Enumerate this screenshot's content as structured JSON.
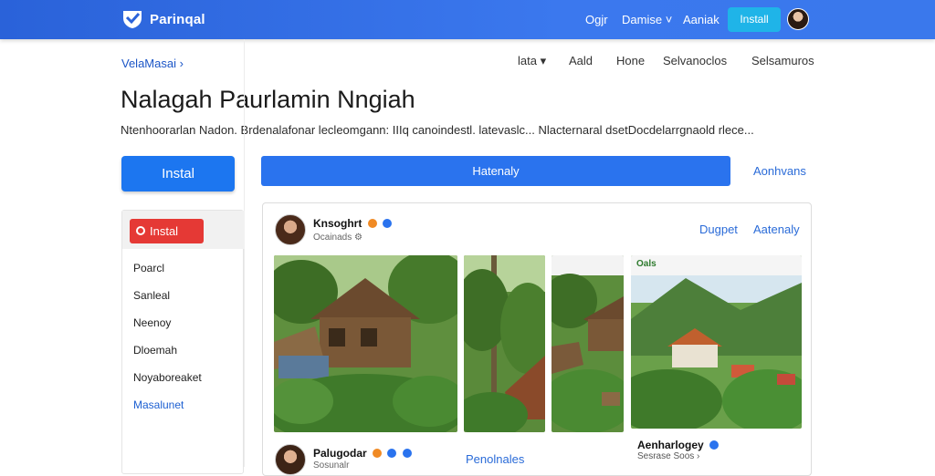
{
  "header": {
    "brand": "Parinqal",
    "nav": [
      "Ogjr",
      "Damise"
    ],
    "nav_third": "Aaniak",
    "install_label": "Install"
  },
  "breadcrumb": "VelaMasai ›",
  "secondary_nav": [
    "lata ▾",
    "Aald",
    "Hone",
    "Selvanoclos",
    "Selsamuros"
  ],
  "page": {
    "title": "Nalagah Paurlamin Nngiah",
    "subtitle": "Ntenhoorarlan Nadon. Brdenalafonar lecleomgann: IIIq canoindestl. latevaslc... Nlacternaral dsetDocdelarrgnaold rlece..."
  },
  "actions": {
    "install_label": "Instal",
    "wide_label": "Hatenaly",
    "right_link": "Aonhvans"
  },
  "sidebar": {
    "red_button": "Instal",
    "items": [
      {
        "label": "Poarcl"
      },
      {
        "label": "Sanleal"
      },
      {
        "label": "Neenoy"
      },
      {
        "label": "Dloemah"
      },
      {
        "label": "Noyaboreaket"
      },
      {
        "label": "Masalunet"
      }
    ]
  },
  "post": {
    "author": "Knsoghrt",
    "meta": "Ocainads",
    "link1": "Dugpet",
    "link2": "Aatenaly",
    "caption_name": "Aenharlogey",
    "caption_meta": "Sesrase Soos ›",
    "photo_label": "Oals"
  },
  "footer_post": {
    "author": "Palugodar",
    "meta": "Sosunalr",
    "link": "Penolnales"
  },
  "colors": {
    "topbar": "#2a62d9",
    "primary": "#1c76f0",
    "red": "#e53935",
    "install_top": "#1fb4e8",
    "link": "#2a6bd8"
  },
  "icons": [
    "shield-logo-icon",
    "chevron-down-icon",
    "verified-icon",
    "gear-icon"
  ]
}
